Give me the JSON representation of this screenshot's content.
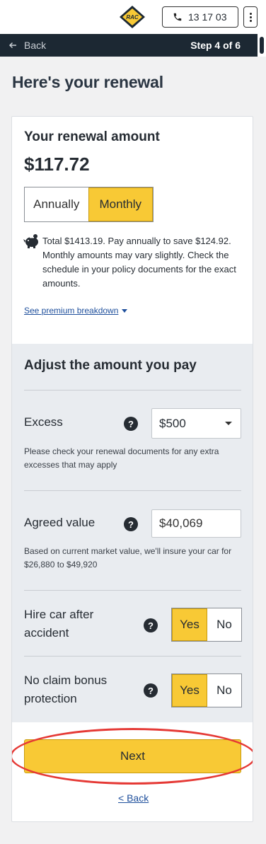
{
  "header": {
    "logo_text": "RAC",
    "phone": "13 17 03"
  },
  "stepbar": {
    "back_label": "Back",
    "step": "Step 4 of 6"
  },
  "page_title": "Here's your renewal",
  "renewal": {
    "label": "Your renewal amount",
    "amount": "$117.72",
    "options": [
      "Annually",
      "Monthly"
    ],
    "selected": "Monthly",
    "info": "Total $1413.19. Pay annually to save $124.92. Monthly amounts may vary slightly. Check the schedule in your policy documents for the exact amounts.",
    "breakdown_link": "See premium breakdown"
  },
  "adjust": {
    "title": "Adjust the amount you pay",
    "excess": {
      "label": "Excess",
      "value": "$500",
      "hint": "Please check your renewal documents for any extra excesses that may apply"
    },
    "agreed_value": {
      "label": "Agreed value",
      "value": "$40,069",
      "hint": "Based on current market value, we'll insure your car for $26,880 to $49,920"
    },
    "hire_car": {
      "label_line1": "Hire car after",
      "label_line2": "accident",
      "yes": "Yes",
      "no": "No",
      "selected": "Yes"
    },
    "ncb": {
      "label_line1": "No claim bonus",
      "label_line2": "protection",
      "yes": "Yes",
      "no": "No",
      "selected": "Yes"
    },
    "help_symbol": "?"
  },
  "actions": {
    "next": "Next",
    "back": "< Back"
  },
  "colors": {
    "accent": "#f8c935",
    "navbar": "#1c2833",
    "link": "#1e4f9c",
    "highlight_ring": "#e53935"
  }
}
